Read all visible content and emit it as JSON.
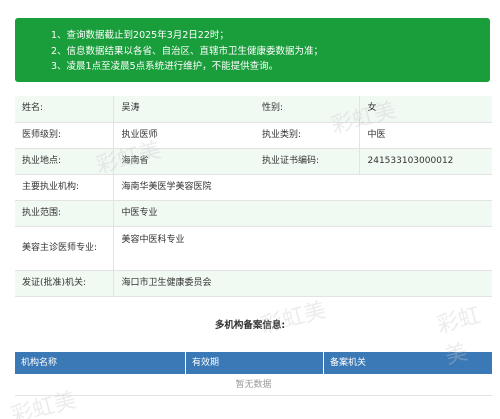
{
  "notice": {
    "lines": [
      "1、查询数据截止到2025年3月2日22时；",
      "2、信息数据结果以各省、自治区、直辖市卫生健康委数据为准；",
      "3、凌晨1点至凌晨5点系统进行维护，不能提供查询。"
    ]
  },
  "info": {
    "name_label": "姓名:",
    "name_value": "吴涛",
    "gender_label": "性别:",
    "gender_value": "女",
    "level_label": "医师级别:",
    "level_value": "执业医师",
    "category_label": "执业类别:",
    "category_value": "中医",
    "location_label": "执业地点:",
    "location_value": "海南省",
    "cert_label": "执业证书编码:",
    "cert_value": "241533103000012",
    "institution_label": "主要执业机构:",
    "institution_value": "海南华美医学美容医院",
    "scope_label": "执业范围:",
    "scope_value": "中医专业",
    "cosmetic_label": "美容主诊医师专业:",
    "cosmetic_value": "美容中医科专业",
    "issuer_label": "发证(批准)机关:",
    "issuer_value": "海口市卫生健康委员会"
  },
  "multi": {
    "title": "多机构备案信息:",
    "headers": [
      "机构名称",
      "有效期",
      "备案机关"
    ],
    "empty_text": "暂无数据"
  },
  "watermark": "彩虹美",
  "colors": {
    "notice_bg": "#1a9e3c",
    "row_tint": "#f1f9f3",
    "table_header": "#3b78b6"
  }
}
